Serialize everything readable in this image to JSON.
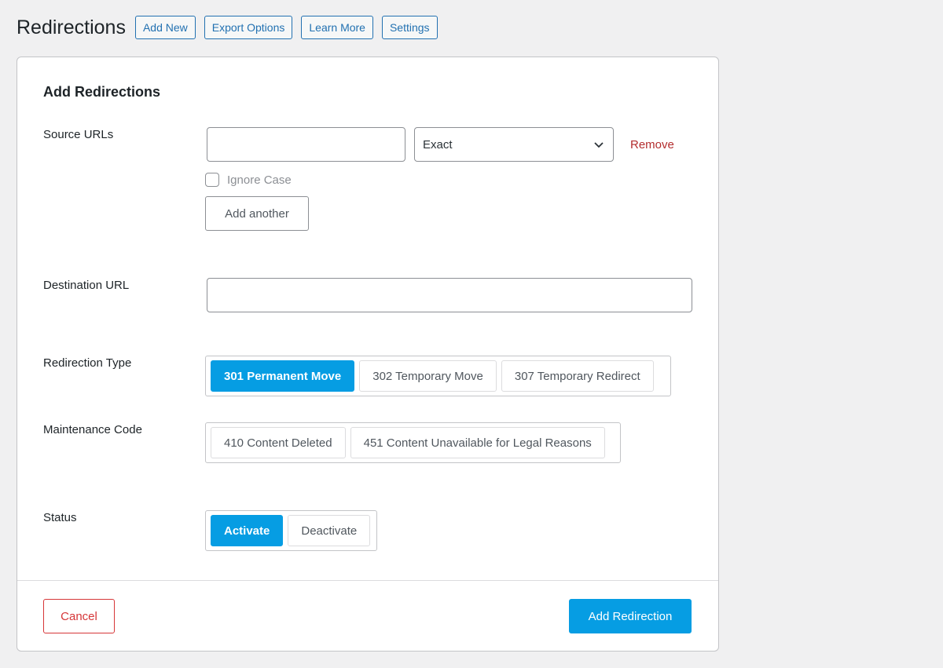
{
  "header": {
    "title": "Redirections",
    "buttons": [
      "Add New",
      "Export Options",
      "Learn More",
      "Settings"
    ]
  },
  "form": {
    "title": "Add Redirections",
    "source": {
      "label": "Source URLs",
      "input_value": "",
      "match_select": "Exact",
      "remove_label": "Remove",
      "ignore_case_label": "Ignore Case",
      "ignore_case_checked": false,
      "add_another_label": "Add another"
    },
    "destination": {
      "label": "Destination URL",
      "input_value": ""
    },
    "redirection_type": {
      "label": "Redirection Type",
      "options": [
        "301 Permanent Move",
        "302 Temporary Move",
        "307 Temporary Redirect"
      ],
      "selected": "301 Permanent Move"
    },
    "maintenance_code": {
      "label": "Maintenance Code",
      "options": [
        "410 Content Deleted",
        "451 Content Unavailable for Legal Reasons"
      ]
    },
    "status": {
      "label": "Status",
      "options": [
        "Activate",
        "Deactivate"
      ],
      "selected": "Activate"
    }
  },
  "footer": {
    "cancel_label": "Cancel",
    "submit_label": "Add Redirection"
  },
  "colors": {
    "accent": "#069de3",
    "link": "#2271b1",
    "danger": "#d63638"
  }
}
